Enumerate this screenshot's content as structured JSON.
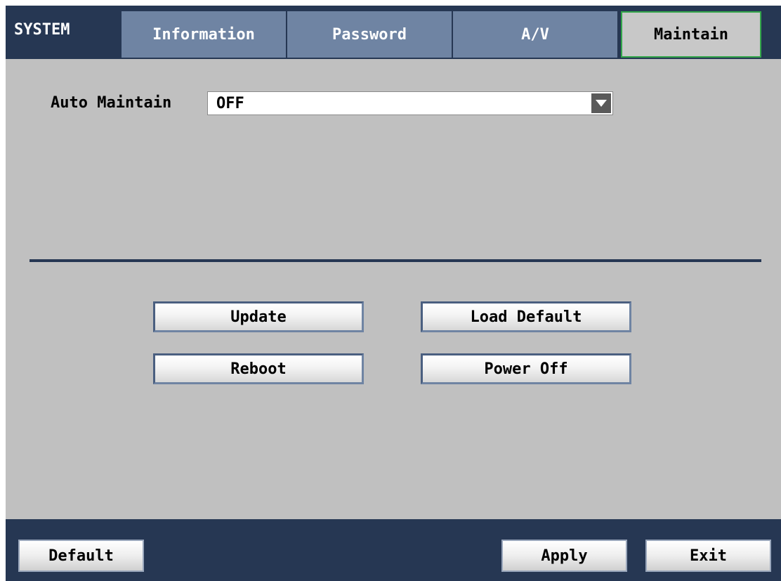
{
  "header": {
    "title": "SYSTEM",
    "tabs": [
      {
        "label": "Information",
        "active": false
      },
      {
        "label": "Password",
        "active": false
      },
      {
        "label": "A/V",
        "active": false
      },
      {
        "label": "Maintain",
        "active": true
      }
    ]
  },
  "maintain": {
    "auto_label": "Auto Maintain",
    "auto_value": "OFF",
    "buttons": {
      "update": "Update",
      "load_default": "Load Default",
      "reboot": "Reboot",
      "power_off": "Power Off"
    }
  },
  "footer": {
    "default_label": "Default",
    "apply_label": "Apply",
    "exit_label": "Exit"
  },
  "colors": {
    "navy": "#263753",
    "tab_inactive": "#6f84a3",
    "panel": "#c0c0c0",
    "active_border": "#33a64a"
  },
  "icons": {
    "dropdown": "chevron-down-icon"
  }
}
